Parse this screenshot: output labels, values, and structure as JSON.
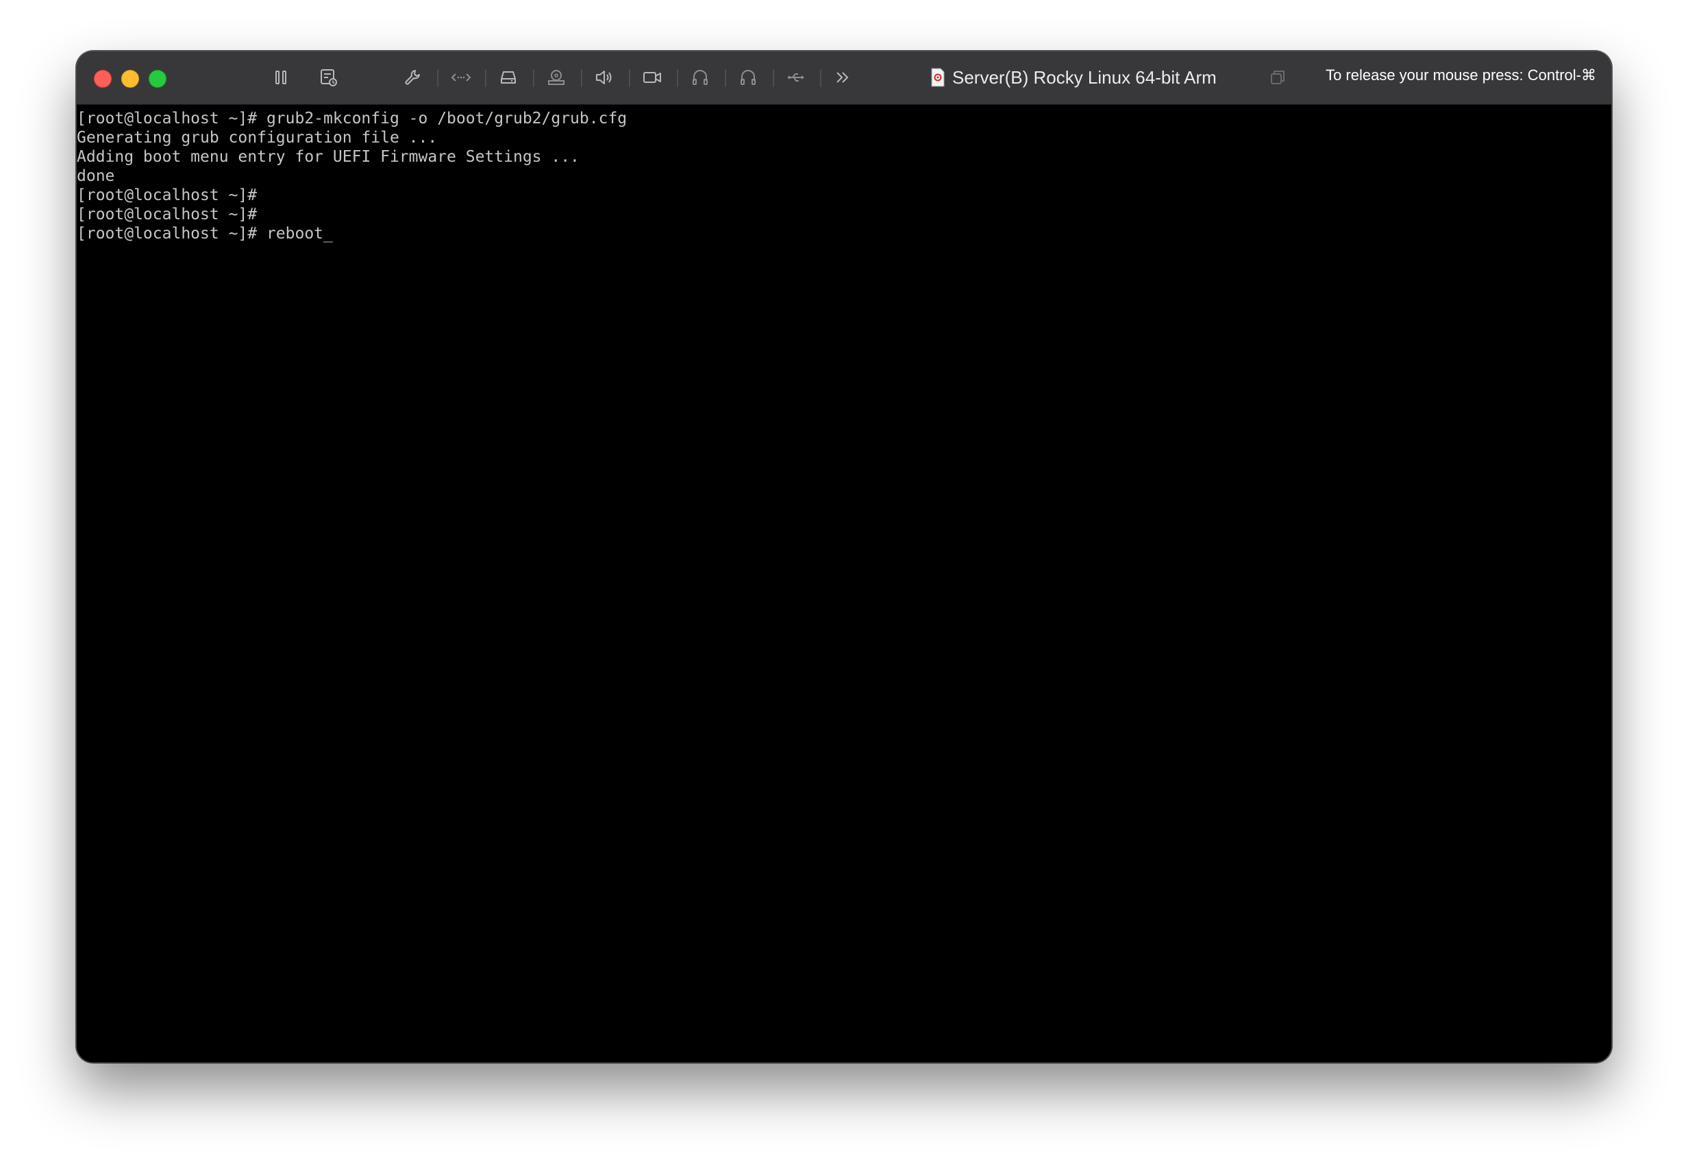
{
  "window": {
    "title": "Server(B) Rocky Linux 64-bit Arm",
    "release_hint": "To release your mouse press: Control-⌘"
  },
  "toolbar": {
    "icons": [
      "pause-icon",
      "snapshot-settings-icon",
      "wrench-icon",
      "network-icon",
      "hard-disk-icon",
      "cd-dvd-icon",
      "sound-icon",
      "camera-icon",
      "headphones-icon",
      "headset-icon",
      "usb-icon",
      "more-icon"
    ]
  },
  "console": {
    "lines": [
      "[root@localhost ~]# grub2-mkconfig -o /boot/grub2/grub.cfg",
      "Generating grub configuration file ...",
      "Adding boot menu entry for UEFI Firmware Settings ...",
      "done",
      "[root@localhost ~]#",
      "[root@localhost ~]#",
      "[root@localhost ~]# reboot"
    ],
    "cursor": "_"
  },
  "colors": {
    "close": "#ff5f57",
    "minimize": "#febc2e",
    "zoom": "#28c840",
    "titlebar": "#38383a",
    "console_bg": "#000000",
    "console_text": "#c6c6c6"
  }
}
